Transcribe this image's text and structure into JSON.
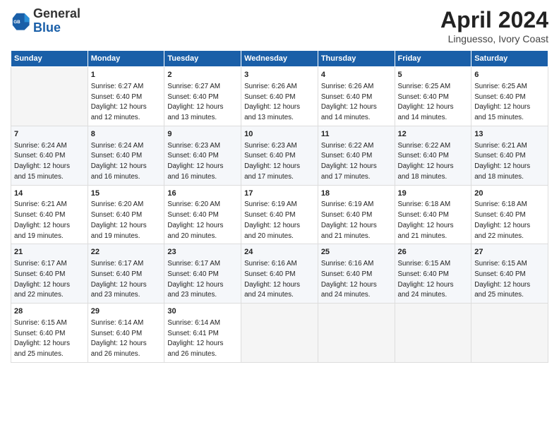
{
  "header": {
    "logo_line1": "General",
    "logo_line2": "Blue",
    "month": "April 2024",
    "location": "Linguesso, Ivory Coast"
  },
  "columns": [
    "Sunday",
    "Monday",
    "Tuesday",
    "Wednesday",
    "Thursday",
    "Friday",
    "Saturday"
  ],
  "weeks": [
    [
      {
        "day": "",
        "info": ""
      },
      {
        "day": "1",
        "info": "Sunrise: 6:27 AM\nSunset: 6:40 PM\nDaylight: 12 hours\nand 12 minutes."
      },
      {
        "day": "2",
        "info": "Sunrise: 6:27 AM\nSunset: 6:40 PM\nDaylight: 12 hours\nand 13 minutes."
      },
      {
        "day": "3",
        "info": "Sunrise: 6:26 AM\nSunset: 6:40 PM\nDaylight: 12 hours\nand 13 minutes."
      },
      {
        "day": "4",
        "info": "Sunrise: 6:26 AM\nSunset: 6:40 PM\nDaylight: 12 hours\nand 14 minutes."
      },
      {
        "day": "5",
        "info": "Sunrise: 6:25 AM\nSunset: 6:40 PM\nDaylight: 12 hours\nand 14 minutes."
      },
      {
        "day": "6",
        "info": "Sunrise: 6:25 AM\nSunset: 6:40 PM\nDaylight: 12 hours\nand 15 minutes."
      }
    ],
    [
      {
        "day": "7",
        "info": "Sunrise: 6:24 AM\nSunset: 6:40 PM\nDaylight: 12 hours\nand 15 minutes."
      },
      {
        "day": "8",
        "info": "Sunrise: 6:24 AM\nSunset: 6:40 PM\nDaylight: 12 hours\nand 16 minutes."
      },
      {
        "day": "9",
        "info": "Sunrise: 6:23 AM\nSunset: 6:40 PM\nDaylight: 12 hours\nand 16 minutes."
      },
      {
        "day": "10",
        "info": "Sunrise: 6:23 AM\nSunset: 6:40 PM\nDaylight: 12 hours\nand 17 minutes."
      },
      {
        "day": "11",
        "info": "Sunrise: 6:22 AM\nSunset: 6:40 PM\nDaylight: 12 hours\nand 17 minutes."
      },
      {
        "day": "12",
        "info": "Sunrise: 6:22 AM\nSunset: 6:40 PM\nDaylight: 12 hours\nand 18 minutes."
      },
      {
        "day": "13",
        "info": "Sunrise: 6:21 AM\nSunset: 6:40 PM\nDaylight: 12 hours\nand 18 minutes."
      }
    ],
    [
      {
        "day": "14",
        "info": "Sunrise: 6:21 AM\nSunset: 6:40 PM\nDaylight: 12 hours\nand 19 minutes."
      },
      {
        "day": "15",
        "info": "Sunrise: 6:20 AM\nSunset: 6:40 PM\nDaylight: 12 hours\nand 19 minutes."
      },
      {
        "day": "16",
        "info": "Sunrise: 6:20 AM\nSunset: 6:40 PM\nDaylight: 12 hours\nand 20 minutes."
      },
      {
        "day": "17",
        "info": "Sunrise: 6:19 AM\nSunset: 6:40 PM\nDaylight: 12 hours\nand 20 minutes."
      },
      {
        "day": "18",
        "info": "Sunrise: 6:19 AM\nSunset: 6:40 PM\nDaylight: 12 hours\nand 21 minutes."
      },
      {
        "day": "19",
        "info": "Sunrise: 6:18 AM\nSunset: 6:40 PM\nDaylight: 12 hours\nand 21 minutes."
      },
      {
        "day": "20",
        "info": "Sunrise: 6:18 AM\nSunset: 6:40 PM\nDaylight: 12 hours\nand 22 minutes."
      }
    ],
    [
      {
        "day": "21",
        "info": "Sunrise: 6:17 AM\nSunset: 6:40 PM\nDaylight: 12 hours\nand 22 minutes."
      },
      {
        "day": "22",
        "info": "Sunrise: 6:17 AM\nSunset: 6:40 PM\nDaylight: 12 hours\nand 23 minutes."
      },
      {
        "day": "23",
        "info": "Sunrise: 6:17 AM\nSunset: 6:40 PM\nDaylight: 12 hours\nand 23 minutes."
      },
      {
        "day": "24",
        "info": "Sunrise: 6:16 AM\nSunset: 6:40 PM\nDaylight: 12 hours\nand 24 minutes."
      },
      {
        "day": "25",
        "info": "Sunrise: 6:16 AM\nSunset: 6:40 PM\nDaylight: 12 hours\nand 24 minutes."
      },
      {
        "day": "26",
        "info": "Sunrise: 6:15 AM\nSunset: 6:40 PM\nDaylight: 12 hours\nand 24 minutes."
      },
      {
        "day": "27",
        "info": "Sunrise: 6:15 AM\nSunset: 6:40 PM\nDaylight: 12 hours\nand 25 minutes."
      }
    ],
    [
      {
        "day": "28",
        "info": "Sunrise: 6:15 AM\nSunset: 6:40 PM\nDaylight: 12 hours\nand 25 minutes."
      },
      {
        "day": "29",
        "info": "Sunrise: 6:14 AM\nSunset: 6:40 PM\nDaylight: 12 hours\nand 26 minutes."
      },
      {
        "day": "30",
        "info": "Sunrise: 6:14 AM\nSunset: 6:41 PM\nDaylight: 12 hours\nand 26 minutes."
      },
      {
        "day": "",
        "info": ""
      },
      {
        "day": "",
        "info": ""
      },
      {
        "day": "",
        "info": ""
      },
      {
        "day": "",
        "info": ""
      }
    ]
  ]
}
